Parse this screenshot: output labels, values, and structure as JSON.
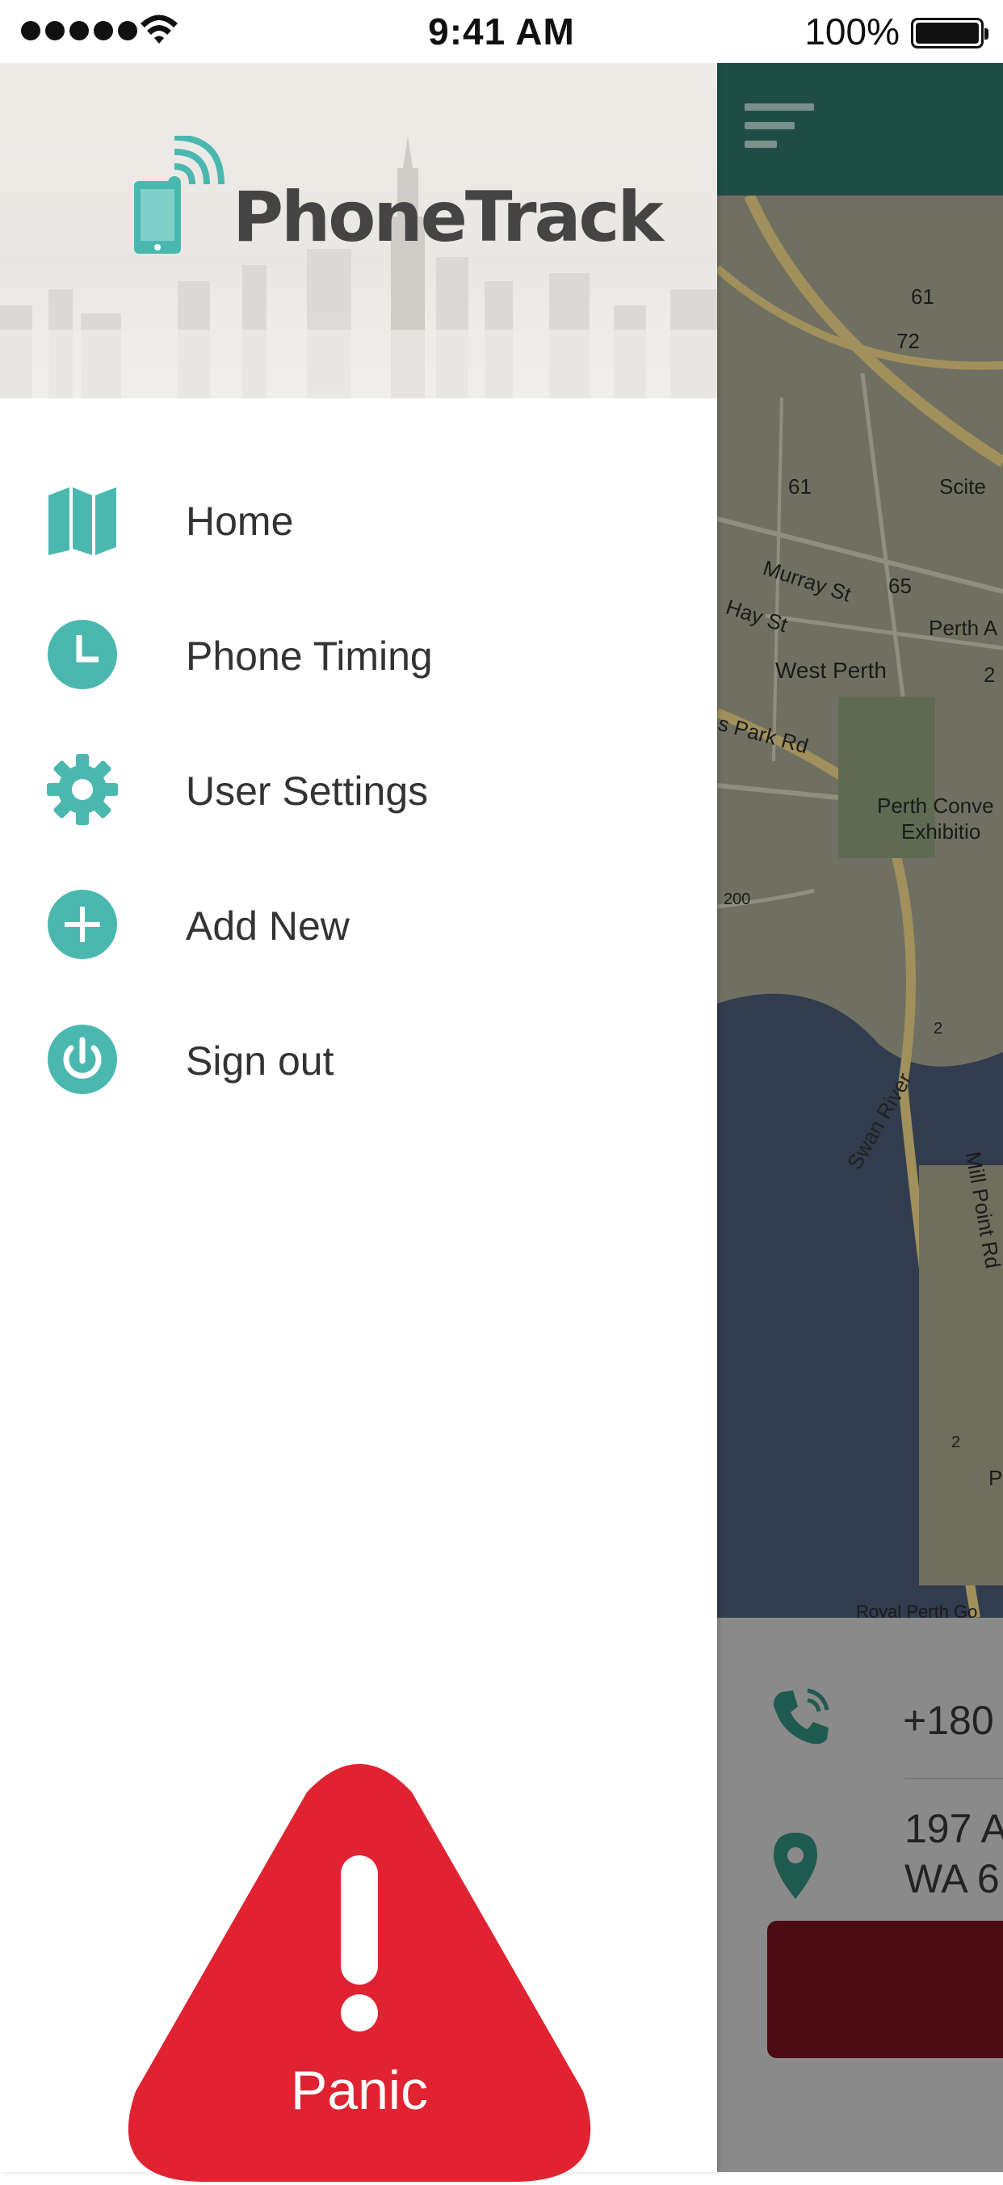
{
  "status_bar": {
    "time": "9:41 AM",
    "battery": "100%"
  },
  "drawer": {
    "app_name": "PhoneTrack",
    "menu": [
      {
        "label": "Home",
        "icon": "map-icon"
      },
      {
        "label": "Phone Timing",
        "icon": "clock-icon"
      },
      {
        "label": "User Settings",
        "icon": "gear-icon"
      },
      {
        "label": "Add New",
        "icon": "plus-icon"
      },
      {
        "label": "Sign out",
        "icon": "power-icon"
      }
    ],
    "panic_label": "Panic"
  },
  "background_app": {
    "phone_partial": "+180",
    "address_partial": "197 A\nWA 6",
    "map_labels": [
      "61",
      "72",
      "Scite",
      "61",
      "Murray St",
      "Hay St",
      "65",
      "Perth A",
      "West Perth",
      "2",
      "s Park Rd",
      "Perth Conve",
      "Exhibitio",
      "200",
      "2",
      "Swan River",
      "Mill Point Rd",
      "2",
      "P",
      "Royal Perth Go"
    ]
  },
  "colors": {
    "accent": "#4bb8b0",
    "panic_red": "#e02231",
    "header_dark": "#1f4d46",
    "text": "#333333"
  }
}
